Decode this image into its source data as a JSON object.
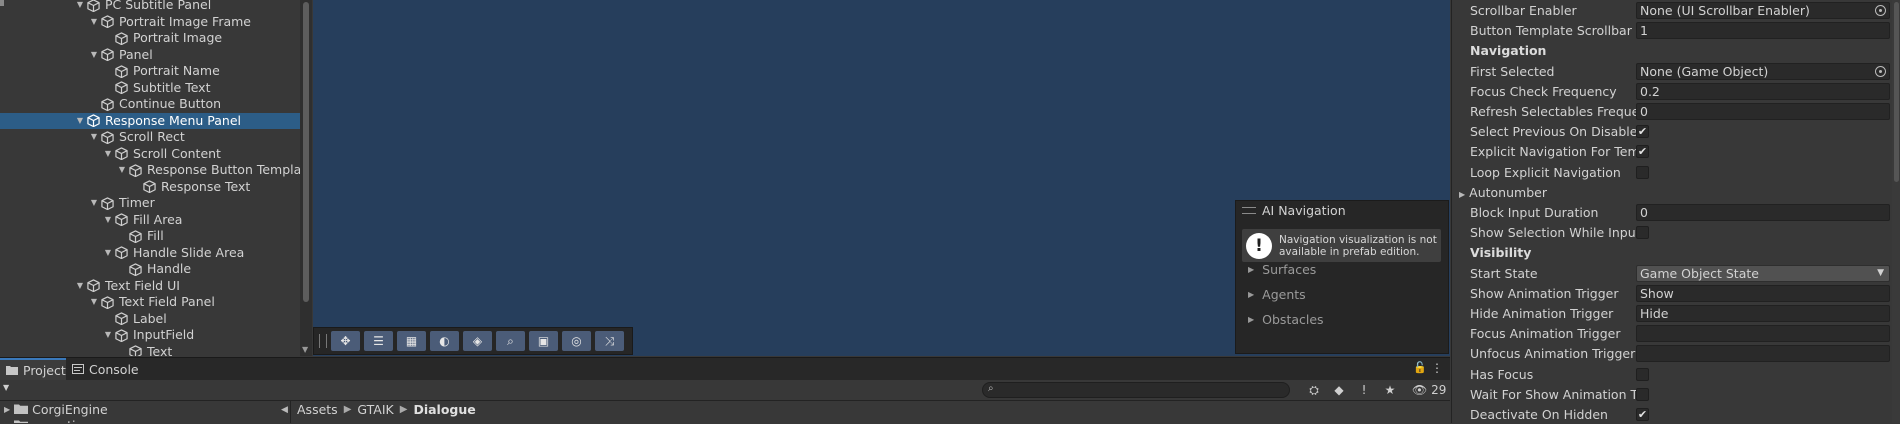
{
  "hierarchy": {
    "items": [
      {
        "label": "PC Subtitle Panel",
        "depth": 0,
        "fold": "open",
        "icon": "cube-icon",
        "selected": false
      },
      {
        "label": "Portrait Image Frame",
        "depth": 1,
        "fold": "open",
        "icon": "cube-icon",
        "selected": false
      },
      {
        "label": "Portrait Image",
        "depth": 2,
        "fold": "none",
        "icon": "cube-icon",
        "selected": false
      },
      {
        "label": "Panel",
        "depth": 1,
        "fold": "open",
        "icon": "cube-icon",
        "selected": false
      },
      {
        "label": "Portrait Name",
        "depth": 2,
        "fold": "none",
        "icon": "cube-icon",
        "selected": false
      },
      {
        "label": "Subtitle Text",
        "depth": 2,
        "fold": "none",
        "icon": "cube-icon",
        "selected": false
      },
      {
        "label": "Continue Button",
        "depth": 1,
        "fold": "none",
        "icon": "cube-icon",
        "selected": false
      },
      {
        "label": "Response Menu Panel",
        "depth": 0,
        "fold": "open",
        "icon": "cube-icon",
        "selected": true
      },
      {
        "label": "Scroll Rect",
        "depth": 1,
        "fold": "open",
        "icon": "cube-icon",
        "selected": false
      },
      {
        "label": "Scroll Content",
        "depth": 2,
        "fold": "open",
        "icon": "cube-icon",
        "selected": false
      },
      {
        "label": "Response Button Template",
        "depth": 3,
        "fold": "open",
        "icon": "cube-icon",
        "selected": false
      },
      {
        "label": "Response Text",
        "depth": 4,
        "fold": "none",
        "icon": "cube-icon",
        "selected": false
      },
      {
        "label": "Timer",
        "depth": 1,
        "fold": "open",
        "icon": "cube-icon",
        "selected": false
      },
      {
        "label": "Fill Area",
        "depth": 2,
        "fold": "open",
        "icon": "cube-icon",
        "selected": false
      },
      {
        "label": "Fill",
        "depth": 3,
        "fold": "none",
        "icon": "cube-icon",
        "selected": false
      },
      {
        "label": "Handle Slide Area",
        "depth": 2,
        "fold": "open",
        "icon": "cube-icon",
        "selected": false
      },
      {
        "label": "Handle",
        "depth": 3,
        "fold": "none",
        "icon": "cube-icon",
        "selected": false
      },
      {
        "label": "Text Field UI",
        "depth": 0,
        "fold": "open",
        "icon": "cube-icon",
        "selected": false
      },
      {
        "label": "Text Field Panel",
        "depth": 1,
        "fold": "open",
        "icon": "cube-icon",
        "selected": false
      },
      {
        "label": "Label",
        "depth": 2,
        "fold": "none",
        "icon": "cube-icon",
        "selected": false
      },
      {
        "label": "InputField",
        "depth": 2,
        "fold": "open",
        "icon": "cube-icon",
        "selected": false
      },
      {
        "label": "Text",
        "depth": 3,
        "fold": "none",
        "icon": "cube-icon",
        "selected": false
      }
    ]
  },
  "scene": {
    "background": "#263e5c",
    "toolbar": {
      "buttons": [
        {
          "name": "move-tool-icon",
          "glyph": "✥"
        },
        {
          "name": "transform-tool-icon",
          "glyph": "☰"
        },
        {
          "name": "grid-snap-icon",
          "glyph": "▦"
        },
        {
          "name": "orientation-icon",
          "glyph": "◐"
        },
        {
          "name": "layers-icon",
          "glyph": "◈"
        },
        {
          "name": "zoom-icon",
          "glyph": "⌕"
        },
        {
          "name": "camera-icon",
          "glyph": "▣"
        },
        {
          "name": "navigation-icon",
          "glyph": "◎"
        },
        {
          "name": "shuffle-icon",
          "glyph": "⤨"
        }
      ]
    },
    "ai_navigation": {
      "title": "AI Navigation",
      "message": "Navigation visualization is not available in prefab edition.",
      "sections": [
        "Surfaces",
        "Agents",
        "Obstacles"
      ]
    }
  },
  "inspector": {
    "rows": [
      {
        "type": "object",
        "label": "Scrollbar Enabler",
        "value": "None (UI Scrollbar Enabler)"
      },
      {
        "type": "text",
        "label": "Button Template Scrollbar Re",
        "value": "1"
      },
      {
        "type": "header",
        "label": "Navigation"
      },
      {
        "type": "object",
        "label": "First Selected",
        "value": "None (Game Object)"
      },
      {
        "type": "text",
        "label": "Focus Check Frequency",
        "value": "0.2"
      },
      {
        "type": "text",
        "label": "Refresh Selectables Frequen",
        "value": "0"
      },
      {
        "type": "check",
        "label": "Select Previous On Disable",
        "checked": true
      },
      {
        "type": "check",
        "label": "Explicit Navigation For Temp",
        "checked": true
      },
      {
        "type": "check",
        "label": "Loop Explicit Navigation",
        "checked": false
      },
      {
        "type": "fold",
        "label": "Autonumber"
      },
      {
        "type": "text",
        "label": "Block Input Duration",
        "value": "0"
      },
      {
        "type": "check",
        "label": "Show Selection While Input B",
        "checked": false
      },
      {
        "type": "header",
        "label": "Visibility"
      },
      {
        "type": "dropdown",
        "label": "Start State",
        "value": "Game Object State"
      },
      {
        "type": "text",
        "label": "Show Animation Trigger",
        "value": "Show"
      },
      {
        "type": "text",
        "label": "Hide Animation Trigger",
        "value": "Hide"
      },
      {
        "type": "text",
        "label": "Focus Animation Trigger",
        "value": ""
      },
      {
        "type": "text",
        "label": "Unfocus Animation Trigger",
        "value": ""
      },
      {
        "type": "check",
        "label": "Has Focus",
        "checked": false
      },
      {
        "type": "check",
        "label": "Wait For Show Animation To",
        "checked": false
      },
      {
        "type": "check",
        "label": "Deactivate On Hidden",
        "checked": true
      }
    ],
    "check_glyph": "✔"
  },
  "bottom": {
    "tabs": [
      {
        "label": "Project",
        "active": true
      },
      {
        "label": "Console",
        "active": false
      }
    ],
    "lock_glyph": "🔓",
    "menu_glyph": "⋮",
    "search": {
      "placeholder": "",
      "icon_glyph": "⌕"
    },
    "hidden_packages_count": "29",
    "tools": [
      {
        "name": "search-by-type-icon",
        "glyph": "⛭"
      },
      {
        "name": "search-by-label-icon",
        "glyph": "◆"
      },
      {
        "name": "info-icon",
        "glyph": "!"
      },
      {
        "name": "favorite-icon",
        "glyph": "★"
      }
    ],
    "eye_glyph": "👁",
    "tree": [
      {
        "label": "CorgiEngine"
      },
      {
        "label": "coroutine"
      }
    ],
    "breadcrumb": [
      "Assets",
      "GTAIK",
      "Dialogue"
    ]
  }
}
